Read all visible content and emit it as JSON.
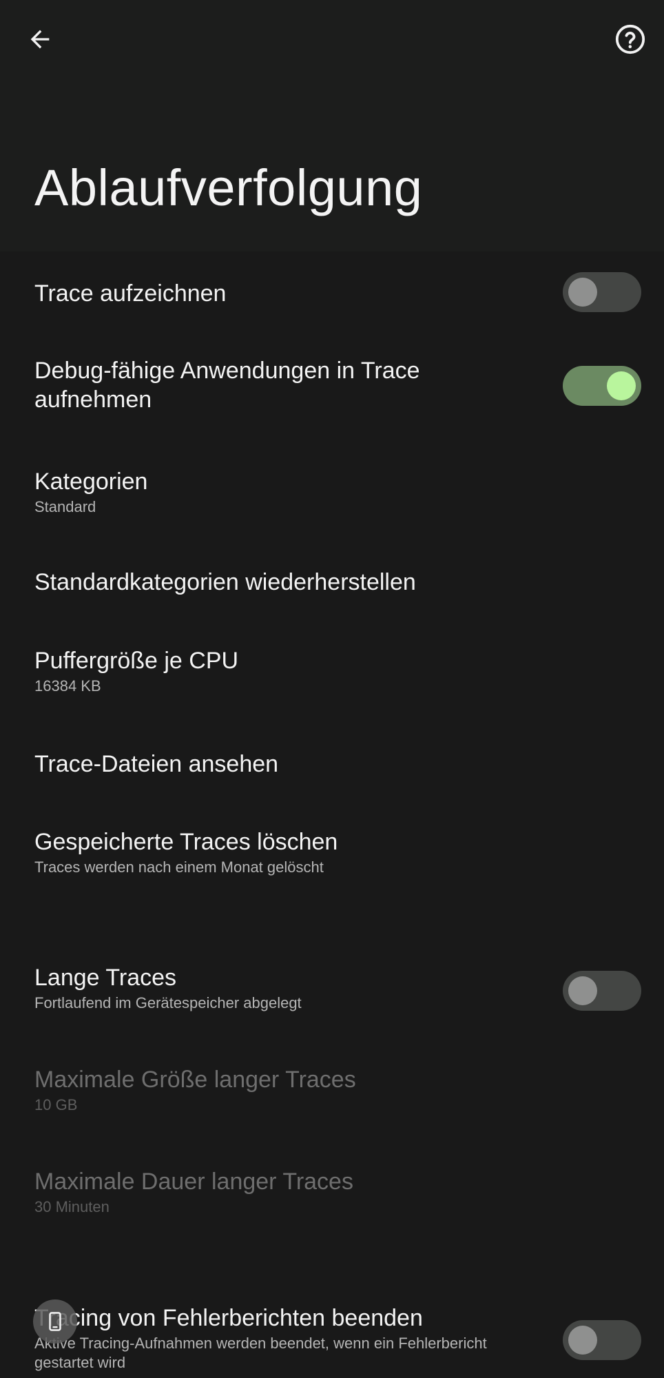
{
  "header": {
    "title": "Ablaufverfolgung",
    "back_icon": "arrow-left-icon",
    "help_icon": "help-circle-icon"
  },
  "settings": {
    "record_trace": {
      "title": "Trace aufzeichnen",
      "enabled": false
    },
    "debuggable_apps": {
      "title": "Debug-fähige Anwendungen in Trace aufnehmen",
      "enabled": true
    },
    "categories": {
      "title": "Kategorien",
      "summary": "Standard"
    },
    "restore_categories": {
      "title": "Standardkategorien wiederherstellen"
    },
    "buffer_size": {
      "title": "Puffergröße je CPU",
      "summary": "16384 KB"
    },
    "view_traces": {
      "title": "Trace-Dateien ansehen"
    },
    "clear_traces": {
      "title": "Gespeicherte Traces löschen",
      "summary": "Traces werden nach einem Monat gelöscht"
    },
    "long_traces": {
      "title": "Lange Traces",
      "summary": "Fortlaufend im Gerätespeicher abgelegt",
      "enabled": false
    },
    "max_long_trace_size": {
      "title": "Maximale Größe langer Traces",
      "summary": "10 GB"
    },
    "max_long_trace_duration": {
      "title": "Maximale Dauer langer Traces",
      "summary": "30 Minuten"
    },
    "stop_on_bugreport": {
      "title": "Tracing von Fehlerberichten beenden",
      "summary": "Aktive Tracing-Aufnahmen werden beendet, wenn ein Fehlerbericht gestartet wird",
      "enabled": false
    }
  },
  "floating_button": {
    "icon": "phone-icon"
  },
  "colors": {
    "background": "#191919",
    "appbar": "#1c1d1c",
    "switch_on_track": "#6b8a62",
    "switch_on_thumb": "#b9f59d",
    "switch_off_track": "#444644",
    "switch_off_thumb": "#8f908f"
  }
}
